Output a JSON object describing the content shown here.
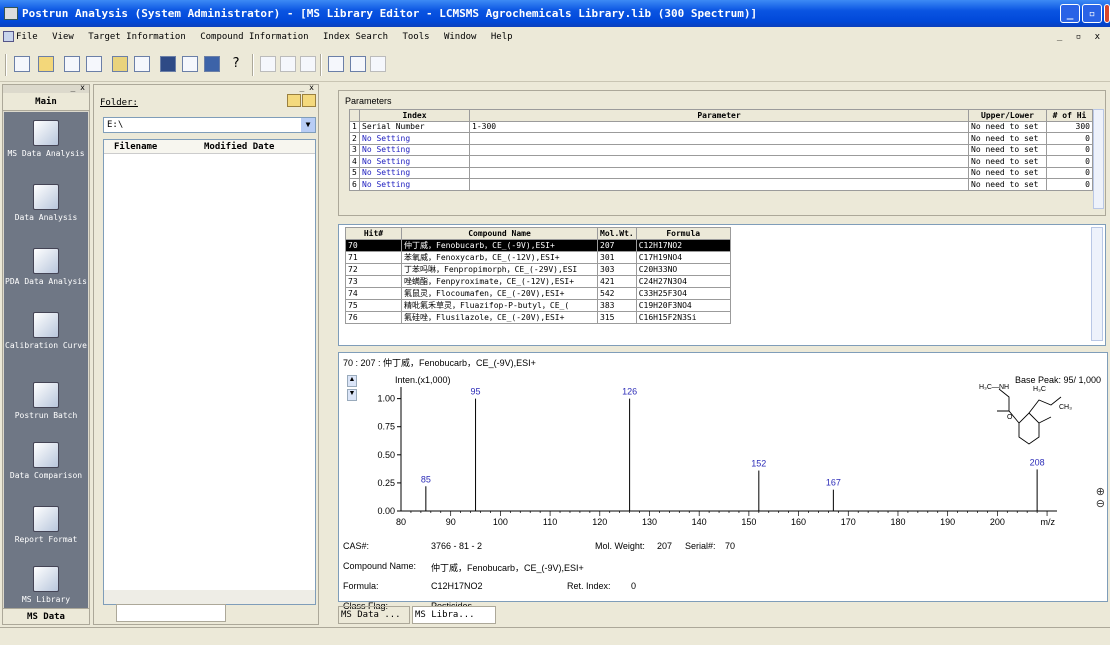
{
  "window": {
    "title": "Postrun Analysis (System Administrator) - [MS Library Editor - LCMSMS Agrochemicals Library.lib (300 Spectrum)]"
  },
  "menu": [
    "File",
    "View",
    "Target Information",
    "Compound Information",
    "Index Search",
    "Tools",
    "Window",
    "Help"
  ],
  "sidebar": {
    "header": "Main",
    "items": [
      {
        "label": "MS Data Analysis",
        "icon": "ms-data-analysis-icon"
      },
      {
        "label": "Data Analysis",
        "icon": "data-analysis-icon"
      },
      {
        "label": "PDA Data Analysis",
        "icon": "pda-data-analysis-icon"
      },
      {
        "label": "Calibration Curve",
        "icon": "calibration-curve-icon"
      },
      {
        "label": "Postrun Batch",
        "icon": "postrun-batch-icon"
      },
      {
        "label": "Data Comparison",
        "icon": "data-comparison-icon"
      },
      {
        "label": "Report Format",
        "icon": "report-format-icon"
      },
      {
        "label": "MS Library",
        "icon": "ms-library-icon"
      }
    ],
    "footer": "MS Data"
  },
  "files": {
    "folder_label": "Folder:",
    "folder_value": "E:\\",
    "col_filename": "Filename",
    "col_modified": "Modified Date"
  },
  "parameters": {
    "title": "Parameters",
    "headers": [
      "Index",
      "Parameter",
      "Upper/Lower",
      "# of Hi"
    ],
    "rows": [
      {
        "idx": "1",
        "index": "Serial Number",
        "param": "1-300",
        "ul": "No need to set",
        "hits": "300"
      },
      {
        "idx": "2",
        "index": "No Setting",
        "param": "",
        "ul": "No need to set",
        "hits": "0"
      },
      {
        "idx": "3",
        "index": "No Setting",
        "param": "",
        "ul": "No need to set",
        "hits": "0"
      },
      {
        "idx": "4",
        "index": "No Setting",
        "param": "",
        "ul": "No need to set",
        "hits": "0"
      },
      {
        "idx": "5",
        "index": "No Setting",
        "param": "",
        "ul": "No need to set",
        "hits": "0"
      },
      {
        "idx": "6",
        "index": "No Setting",
        "param": "",
        "ul": "No need to set",
        "hits": "0"
      }
    ]
  },
  "hits": {
    "headers": [
      "Hit#",
      "Compound Name",
      "Mol.Wt.",
      "Formula"
    ],
    "rows": [
      {
        "hit": "70",
        "name": "仲丁威，Fenobucarb，CE_(-9V),ESI+",
        "mw": "207",
        "formula": "C12H17NO2"
      },
      {
        "hit": "71",
        "name": "苯氧威，Fenoxycarb，CE_(-12V),ESI+",
        "mw": "301",
        "formula": "C17H19NO4"
      },
      {
        "hit": "72",
        "name": "丁苯吗啉，Fenpropimorph，CE_(-29V),ESI",
        "mw": "303",
        "formula": "C20H33NO"
      },
      {
        "hit": "73",
        "name": "唑螨酯，Fenpyroximate，CE_(-12V),ESI+",
        "mw": "421",
        "formula": "C24H27N3O4"
      },
      {
        "hit": "74",
        "name": "氟鼠灵，Flocoumafen，CE_(-20V),ESI+",
        "mw": "542",
        "formula": "C33H25F3O4"
      },
      {
        "hit": "75",
        "name": "精吡氟禾草灵，Fluazifop-P-butyl，CE_(",
        "mw": "383",
        "formula": "C19H20F3NO4"
      },
      {
        "hit": "76",
        "name": "氟硅唑，Flusilazole，CE_(-20V),ESI+",
        "mw": "315",
        "formula": "C16H15F2N3Si"
      }
    ]
  },
  "spectrum": {
    "caption": "70 : 207 : 仲丁威，Fenobucarb，CE_(-9V),ESI+",
    "inten_label": "Inten.(x1,000)",
    "base_peak": "Base Peak: 95/ 1,000",
    "xunit": "m/z",
    "cas_label": "CAS#:",
    "cas_value": "3766 - 81 - 2",
    "molwt_label": "Mol. Weight:",
    "molwt_value": "207",
    "serial_label": "Serial#:",
    "serial_value": "70",
    "compound_label": "Compound Name:",
    "compound_value": "仲丁威，Fenobucarb，CE_(-9V),ESI+",
    "formula_label": "Formula:",
    "formula_value": "C12H17NO2",
    "retidx_label": "Ret. Index:",
    "retidx_value": "0",
    "class_label": "Class Flag:",
    "class_value": "Pesticides"
  },
  "chart_data": {
    "type": "bar",
    "x": [
      85,
      95,
      126,
      152,
      167,
      208
    ],
    "values": [
      0.22,
      1.0,
      1.0,
      0.36,
      0.19,
      0.37
    ],
    "labels": [
      "85",
      "95",
      "126",
      "152",
      "167",
      "208"
    ],
    "xlim": [
      80,
      212
    ],
    "ylim": [
      0,
      1.05
    ],
    "xticks": [
      "80",
      "90",
      "100",
      "110",
      "120",
      "130",
      "140",
      "150",
      "160",
      "170",
      "180",
      "190",
      "200"
    ],
    "yticks": [
      "0.00",
      "0.25",
      "0.50",
      "0.75",
      "1.00"
    ],
    "xlabel": "m/z",
    "ylabel": "Inten.(x1,000)"
  },
  "tabs": [
    "MS Data ...",
    "MS Libra..."
  ]
}
